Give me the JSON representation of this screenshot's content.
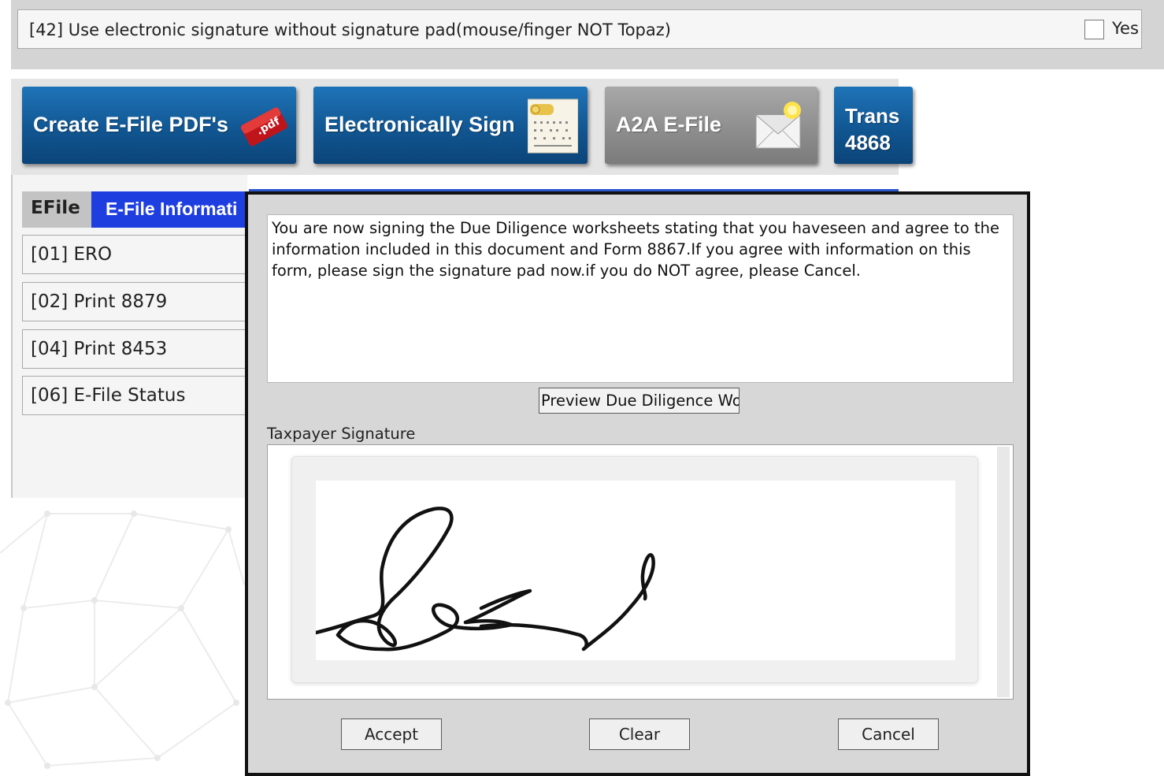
{
  "top_option": {
    "label": "[42] Use electronic signature without signature pad(mouse/finger NOT Topaz)",
    "checkbox_checked": false,
    "checkbox_label": "Yes"
  },
  "toolbar": {
    "buttons": [
      {
        "label": "Create E-File PDF's",
        "icon": "pdf-icon",
        "color": "#10548f"
      },
      {
        "label": "Electronically Sign",
        "icon": "sign-document-icon",
        "color": "#10548f"
      },
      {
        "label": "A2A E-File",
        "icon": "envelope-icon",
        "color": "#8c8c8c"
      },
      {
        "label_line1": "Trans",
        "label_line2": "4868",
        "color": "#10548f"
      }
    ]
  },
  "efile_panel": {
    "tab_efile": "EFile",
    "tab_info": "E-File Informati",
    "items": [
      {
        "label": "[01] ERO"
      },
      {
        "label": "[02] Print 8879"
      },
      {
        "label": "[04] Print 8453"
      },
      {
        "label": "[06] E-File Status"
      }
    ]
  },
  "dialog": {
    "message": "You are now signing the Due Diligence worksheets stating that you haveseen and agree to the information included in this document and Form 8867.If you agree with information on this form, please sign the signature pad now.if you do NOT agree, please Cancel.",
    "preview_button": "Preview Due Diligence Work",
    "signature_label": "Taxpayer Signature",
    "accept_label": "Accept",
    "clear_label": "Clear",
    "cancel_label": "Cancel"
  },
  "colors": {
    "button_blue": "#10548f",
    "button_gray": "#8c8c8c",
    "tab_blue": "#1f3ee0"
  }
}
